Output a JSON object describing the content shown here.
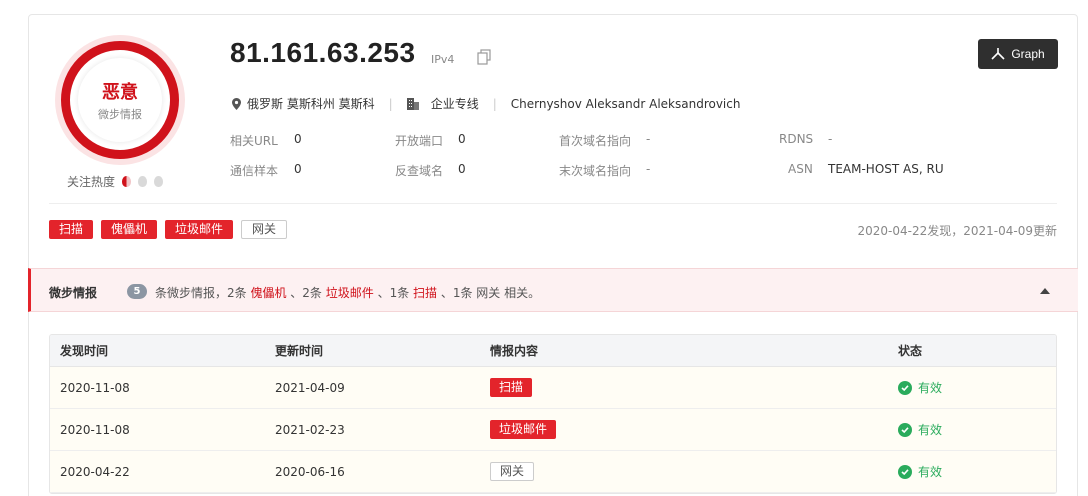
{
  "verdict": {
    "label": "恶意",
    "sub": "微步情报"
  },
  "heat": {
    "label": "关注热度"
  },
  "ip": {
    "address": "81.161.63.253",
    "version": "IPv4"
  },
  "graph_button": {
    "label": "Graph"
  },
  "location": {
    "place": "俄罗斯 莫斯科州 莫斯科",
    "type": "企业专线",
    "owner": "Chernyshov Aleksandr Aleksandrovich"
  },
  "stats": {
    "related_url": {
      "k": "相关URL",
      "v": "0"
    },
    "open_ports": {
      "k": "开放端口",
      "v": "0"
    },
    "first_domain": {
      "k": "首次域名指向",
      "v": "-"
    },
    "rdns": {
      "k": "RDNS",
      "v": "-"
    },
    "comm_samples": {
      "k": "通信样本",
      "v": "0"
    },
    "reverse_domains": {
      "k": "反查域名",
      "v": "0"
    },
    "last_domain": {
      "k": "末次域名指向",
      "v": "-"
    },
    "asn": {
      "k": "ASN",
      "v": "TEAM-HOST AS, RU"
    }
  },
  "tags": [
    "扫描",
    "傀儡机",
    "垃圾邮件",
    "网关"
  ],
  "dates_text": "2020-04-22发现，2021-04-09更新",
  "intel": {
    "title": "微步情报",
    "count": "5",
    "s1": "条微步情报，2条 ",
    "t1": "傀儡机",
    "s2": " 、2条 ",
    "t2": "垃圾邮件",
    "s3": " 、1条 ",
    "t3": "扫描",
    "s4": " 、1条 网关 相关。"
  },
  "table": {
    "headers": [
      "发现时间",
      "更新时间",
      "情报内容",
      "状态"
    ],
    "rows": [
      {
        "found": "2020-11-08",
        "updated": "2021-04-09",
        "content": "扫描",
        "status": "有效"
      },
      {
        "found": "2020-11-08",
        "updated": "2021-02-23",
        "content": "垃圾邮件",
        "status": "有效"
      },
      {
        "found": "2020-04-22",
        "updated": "2020-06-16",
        "content": "网关",
        "status": "有效"
      }
    ]
  },
  "colors": {
    "malicious": "#d0121b",
    "tag_red": "#e3242b",
    "valid": "#2aab5c"
  }
}
